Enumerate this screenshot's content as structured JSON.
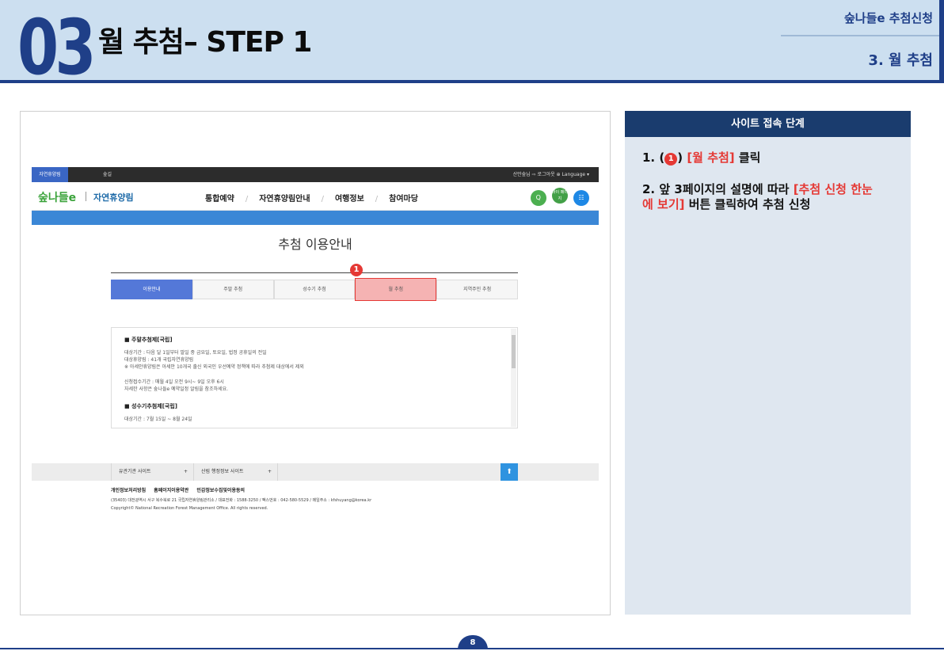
{
  "header": {
    "section_number": "03",
    "title": "월 추첨– STEP 1",
    "subtitle_top": "숲나들e 추첨신청",
    "subtitle_bottom": "3. 월 추첨"
  },
  "site": {
    "topbar": {
      "left_tab": "자연휴양림",
      "second_tab": "숲길",
      "right": "산만숲님  ⇨ 로그아웃  ⊕ Language ▾"
    },
    "logo": "숲나들e",
    "logo_sub": "자연휴양림",
    "menu": [
      "통합예약",
      "자연휴양림안내",
      "여행정보",
      "참여마당"
    ],
    "icon_labels": [
      "Q",
      "마이 페이지",
      "☷"
    ],
    "page_heading": "추첨 이용안내",
    "tabs": [
      "이용안내",
      "주말 추첨",
      "성수기 추첨",
      "월 추첨",
      "지역주민 추첨"
    ],
    "notice": {
      "heading1": "■ 주말추첨제[국립]",
      "lines1": [
        "대상기간 : 다음 달 1일부터 말일 중 금요일, 토요일, 법정 공휴일의 전일",
        "대상휴양림 : 41개 국립자연휴양림",
        "※ 아세안휴양림은 아세안 10개국 출신 외국인 우선예약 정책에 따라 추첨제 대상에서 제외"
      ],
      "lines2": [
        "신청접수기간 : 매월 4일 오전 9시~ 9일 오후 6시",
        "자세한 사항은 숲나들e 예약일정 알림을 참조하세요."
      ],
      "heading2": "■ 성수기추첨제[국립]",
      "cut_line": "대상기간 : 7월 15일 ~ 8월 24일"
    },
    "footbar": {
      "item1": "유관기관 사이트",
      "item2": "산림 행정정보 사이트",
      "plus": "+",
      "top_icon": "⬆"
    },
    "footer": {
      "links": [
        "개인정보처리방침",
        "홈페이지이용약관",
        "민감정보수집및이용동의"
      ],
      "address": "(35403) 대전광역시 서구 복수북로 21 국립자연휴양림관리소  /  대표전화 : 1588-3250  /  팩스번호 : 042-580-5529  /  메일주소 : kfshuyang@korea.kr",
      "copyright": "Copyright© National Recreation Forest Management Office. All rights reserved."
    },
    "badge": "1"
  },
  "panel": {
    "title": "사이트 접속 단계",
    "step1": {
      "num": "1. (",
      "badge": "1",
      "close": ")",
      "red": "[월 추첨]",
      "tail": " 클릭"
    },
    "step2": {
      "num": "2. 앞 3페이지의 설명에 따라 ",
      "red": "[추첨 신청 한눈에 보기]",
      "tail": " 버튼 클릭하여 추첨 신청"
    }
  },
  "page_number": "8",
  "colors": {
    "navy": "#1f3f88",
    "accent_red": "#e53935",
    "panel_bg": "#dfe7f0",
    "panel_head": "#1a3c6e"
  }
}
